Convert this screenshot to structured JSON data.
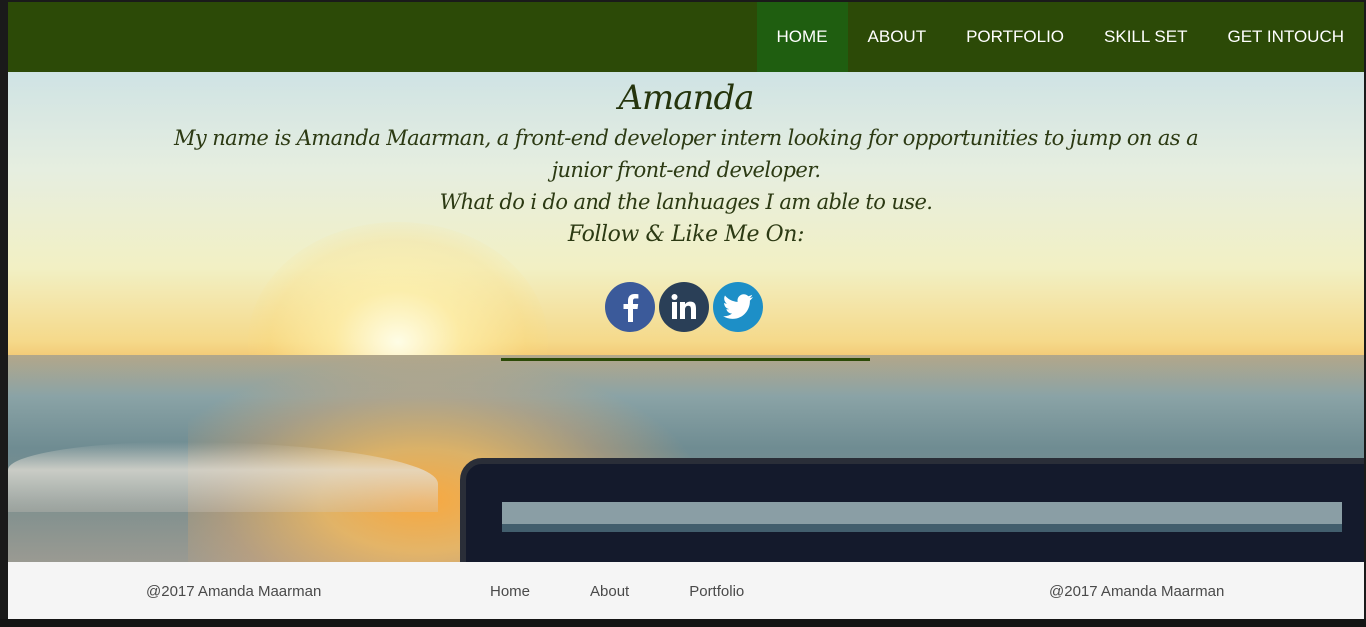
{
  "nav": {
    "items": [
      {
        "label": "HOME"
      },
      {
        "label": "ABOUT"
      },
      {
        "label": "PORTFOLIO"
      },
      {
        "label": "SKILL SET"
      },
      {
        "label": "GET INTOUCH"
      }
    ],
    "active_index": 0,
    "background_color": "#2c4a07",
    "active_color": "#1f5e10"
  },
  "hero": {
    "name": "Amanda",
    "bio": "My name is Amanda Maarman, a front-end developer intern looking for opportunities to jump on as a junior front-end developer.",
    "what": "What do i do and the lanhuages I am able to use.",
    "follow": "Follow & Like Me On:",
    "social": [
      {
        "icon": "facebook-icon",
        "color": "#3b5a9a"
      },
      {
        "icon": "linkedin-icon",
        "color": "#2a3f57"
      },
      {
        "icon": "twitter-icon",
        "color": "#1d8fc7"
      }
    ]
  },
  "footer": {
    "copyright_left": "@2017 Amanda Maarman",
    "links": [
      {
        "label": "Home"
      },
      {
        "label": "About"
      },
      {
        "label": "Portfolio"
      }
    ],
    "copyright_right": "@2017 Amanda Maarman"
  }
}
